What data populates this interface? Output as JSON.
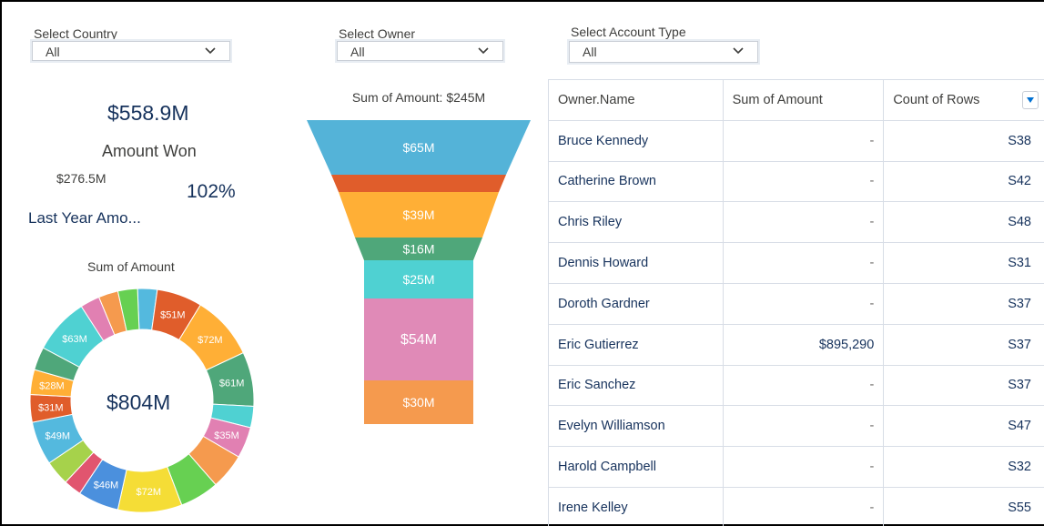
{
  "filters": {
    "country": {
      "label": "Select Country",
      "value": "All"
    },
    "owner": {
      "label": "Select Owner",
      "value": "All"
    },
    "account_type": {
      "label": "Select Account Type",
      "value": "All"
    }
  },
  "kpi": {
    "amount": "$558.9M",
    "amount_label": "Amount Won",
    "last_year": "$276.5M",
    "percent": "102%",
    "last_year_label": "Last Year Amo..."
  },
  "donut": {
    "title": "Sum of Amount",
    "total": "$804M"
  },
  "funnel": {
    "title": "Sum of Amount: $245M"
  },
  "chart_data": [
    {
      "type": "pie",
      "title": "Sum of Amount",
      "center_label": "$804M",
      "slices": [
        {
          "label": "",
          "value": 22,
          "color": "#54b9de"
        },
        {
          "label": "$51M",
          "value": 51,
          "color": "#e05d2b"
        },
        {
          "label": "$72M",
          "value": 72,
          "color": "#ffaf36"
        },
        {
          "label": "$61M",
          "value": 61,
          "color": "#4fa77a"
        },
        {
          "label": "",
          "value": 24,
          "color": "#4fd1d2"
        },
        {
          "label": "$35M",
          "value": 35,
          "color": "#e180b2"
        },
        {
          "label": "",
          "value": 40,
          "color": "#f59a4e"
        },
        {
          "label": "",
          "value": 44,
          "color": "#67d052"
        },
        {
          "label": "$72M",
          "value": 72,
          "color": "#f5dd36"
        },
        {
          "label": "$46M",
          "value": 46,
          "color": "#4b90dd"
        },
        {
          "label": "",
          "value": 20,
          "color": "#e1556f"
        },
        {
          "label": "",
          "value": 28,
          "color": "#a6d24b"
        },
        {
          "label": "$49M",
          "value": 49,
          "color": "#54b9de"
        },
        {
          "label": "$31M",
          "value": 31,
          "color": "#e05d2b"
        },
        {
          "label": "$28M",
          "value": 28,
          "color": "#ffaf36"
        },
        {
          "label": "",
          "value": 26,
          "color": "#4fa77a"
        },
        {
          "label": "$63M",
          "value": 63,
          "color": "#4fd1d2"
        },
        {
          "label": "",
          "value": 22,
          "color": "#e180b2"
        },
        {
          "label": "",
          "value": 22,
          "color": "#f59a4e"
        },
        {
          "label": "",
          "value": 22,
          "color": "#67d052"
        }
      ]
    },
    {
      "type": "bar",
      "subtype": "funnel",
      "title": "Sum of Amount: $245M",
      "segments": [
        {
          "label": "$65M",
          "value": 65,
          "color": "#54b3d8"
        },
        {
          "label": "",
          "value": 8,
          "color": "#e05d2b"
        },
        {
          "label": "$39M",
          "value": 39,
          "color": "#ffaf36"
        },
        {
          "label": "$16M",
          "value": 16,
          "color": "#4fa77a"
        },
        {
          "label": "$25M",
          "value": 25,
          "color": "#4fd1d2"
        },
        {
          "label": "$54M",
          "value": 54,
          "color": "#e08ab7"
        },
        {
          "label": "$30M",
          "value": 30,
          "color": "#f59a4e"
        }
      ]
    }
  ],
  "table": {
    "headers": [
      "Owner.Name",
      "Sum of Amount",
      "Count of Rows"
    ],
    "rows": [
      [
        "Bruce Kennedy",
        "-",
        "S38"
      ],
      [
        "Catherine Brown",
        "-",
        "S42"
      ],
      [
        "Chris Riley",
        "-",
        "S48"
      ],
      [
        "Dennis Howard",
        "-",
        "S31"
      ],
      [
        "Doroth Gardner",
        "-",
        "S37"
      ],
      [
        "Eric Gutierrez",
        "$895,290",
        "S37"
      ],
      [
        "Eric Sanchez",
        "-",
        "S37"
      ],
      [
        "Evelyn Williamson",
        "-",
        "S47"
      ],
      [
        "Harold Campbell",
        "-",
        "S32"
      ],
      [
        "Irene Kelley",
        "-",
        "S55"
      ]
    ]
  }
}
